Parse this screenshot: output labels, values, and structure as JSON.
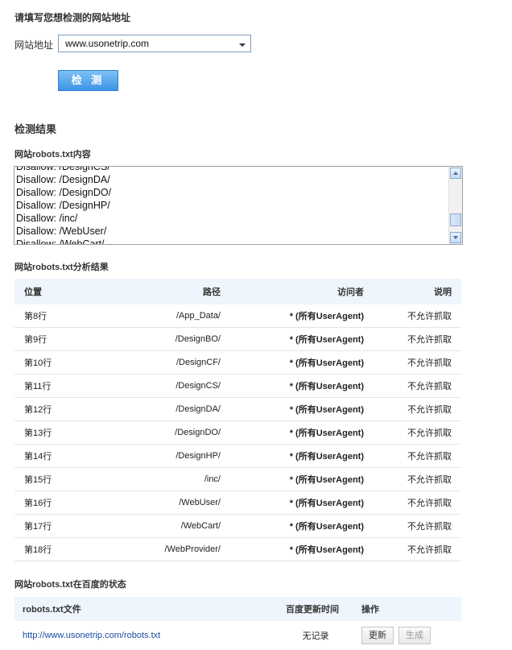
{
  "form": {
    "title": "请填写您想检测的网站地址",
    "url_label": "网站地址",
    "url_value": "www.usonetrip.com",
    "check_button": "检 测"
  },
  "results": {
    "title": "检测结果",
    "robots_content_title": "网站robots.txt内容",
    "robots_lines": [
      "Disallow: /DesignCS/",
      "Disallow: /DesignDA/",
      "Disallow: /DesignDO/",
      "Disallow: /DesignHP/",
      "Disallow: /inc/",
      "Disallow: /WebUser/",
      "Disallow: /WebCart/"
    ],
    "analysis_title": "网站robots.txt分析结果",
    "analysis_headers": [
      "位置",
      "路径",
      "访问者",
      "说明"
    ],
    "analysis_rows": [
      {
        "pos": "第8行",
        "path": "/App_Data/",
        "visitor": "* (所有UserAgent)",
        "desc": "不允许抓取"
      },
      {
        "pos": "第9行",
        "path": "/DesignBO/",
        "visitor": "* (所有UserAgent)",
        "desc": "不允许抓取"
      },
      {
        "pos": "第10行",
        "path": "/DesignCF/",
        "visitor": "* (所有UserAgent)",
        "desc": "不允许抓取"
      },
      {
        "pos": "第11行",
        "path": "/DesignCS/",
        "visitor": "* (所有UserAgent)",
        "desc": "不允许抓取"
      },
      {
        "pos": "第12行",
        "path": "/DesignDA/",
        "visitor": "* (所有UserAgent)",
        "desc": "不允许抓取"
      },
      {
        "pos": "第13行",
        "path": "/DesignDO/",
        "visitor": "* (所有UserAgent)",
        "desc": "不允许抓取"
      },
      {
        "pos": "第14行",
        "path": "/DesignHP/",
        "visitor": "* (所有UserAgent)",
        "desc": "不允许抓取"
      },
      {
        "pos": "第15行",
        "path": "/inc/",
        "visitor": "* (所有UserAgent)",
        "desc": "不允许抓取"
      },
      {
        "pos": "第16行",
        "path": "/WebUser/",
        "visitor": "* (所有UserAgent)",
        "desc": "不允许抓取"
      },
      {
        "pos": "第17行",
        "path": "/WebCart/",
        "visitor": "* (所有UserAgent)",
        "desc": "不允许抓取"
      },
      {
        "pos": "第18行",
        "path": "/WebProvider/",
        "visitor": "* (所有UserAgent)",
        "desc": "不允许抓取"
      }
    ],
    "baidu_title": "网站robots.txt在百度的状态",
    "baidu_headers": [
      "robots.txt文件",
      "百度更新时间",
      "操作"
    ],
    "baidu_row": {
      "file": "http://www.usonetrip.com/robots.txt",
      "time": "无记录",
      "update_button": "更新",
      "generate_button": "生成"
    }
  }
}
